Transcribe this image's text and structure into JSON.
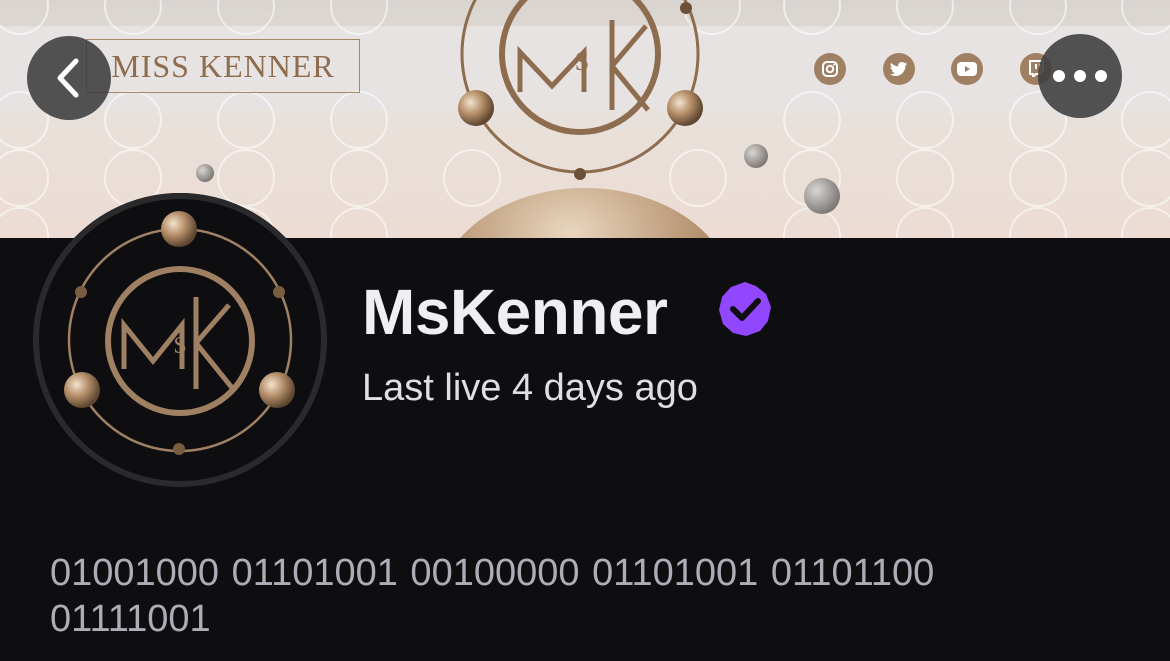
{
  "banner": {
    "brand_text": "MISS KENNER",
    "monogram_text": "MSK",
    "accent_color": "#a08063",
    "social_icons": [
      "instagram-icon",
      "twitter-icon",
      "youtube-icon",
      "twitch-icon"
    ]
  },
  "nav": {
    "back_icon": "chevron-left-icon",
    "more_icon": "more-dots-icon"
  },
  "channel": {
    "name": "MsKenner",
    "verified_color": "#9147ff",
    "last_live": "Last live 4 days ago",
    "bio": "01001000 01101001 00100000 01101001 01101100 01111001"
  }
}
